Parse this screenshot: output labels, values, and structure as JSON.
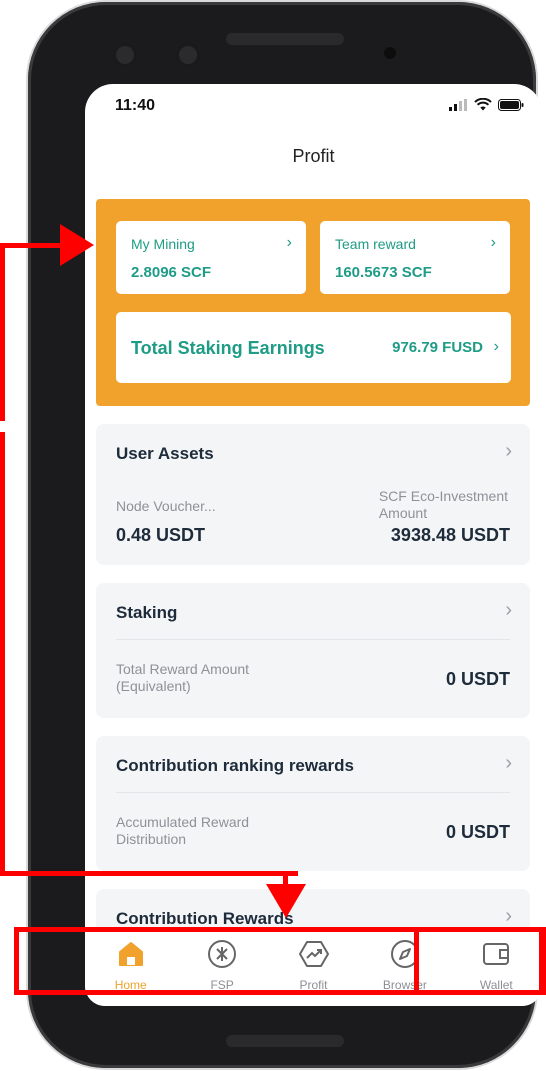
{
  "status_bar": {
    "time": "11:40"
  },
  "header": {
    "title": "Profit"
  },
  "summary": {
    "my_mining": {
      "label": "My Mining",
      "value": "2.8096 SCF"
    },
    "team_reward": {
      "label": "Team reward",
      "value": "160.5673 SCF"
    },
    "total_staking": {
      "label": "Total Staking Earnings",
      "value": "976.79 FUSD"
    },
    "chevron": "›"
  },
  "sections": {
    "user_assets": {
      "title": "User Assets",
      "left_label": "Node Voucher...",
      "left_value": "0.48 USDT",
      "right_label_line1": "SCF Eco-Investment",
      "right_label_line2": "Amount",
      "right_value": "3938.48 USDT"
    },
    "staking": {
      "title": "Staking",
      "label_line1": "Total Reward Amount",
      "label_line2": "(Equivalent)",
      "value": "0 USDT"
    },
    "contribution_ranking": {
      "title": "Contribution ranking rewards",
      "label_line1": "Accumulated Reward",
      "label_line2": "Distribution",
      "value": "0 USDT"
    },
    "contribution_rewards": {
      "title": "Contribution Rewards"
    },
    "chevron": "›"
  },
  "bottom_nav": {
    "items": [
      {
        "label": "Home",
        "icon": "home-icon",
        "active": true
      },
      {
        "label": "FSP",
        "icon": "fsp-coin-icon",
        "active": false
      },
      {
        "label": "Profit",
        "icon": "profit-trend-icon",
        "active": false
      },
      {
        "label": "Browser",
        "icon": "compass-icon",
        "active": false
      },
      {
        "label": "Wallet",
        "icon": "wallet-icon",
        "active": false
      }
    ]
  },
  "colors": {
    "accent_orange": "#f0a22c",
    "accent_teal": "#1e9c86",
    "annotation_red": "#ff0000"
  }
}
